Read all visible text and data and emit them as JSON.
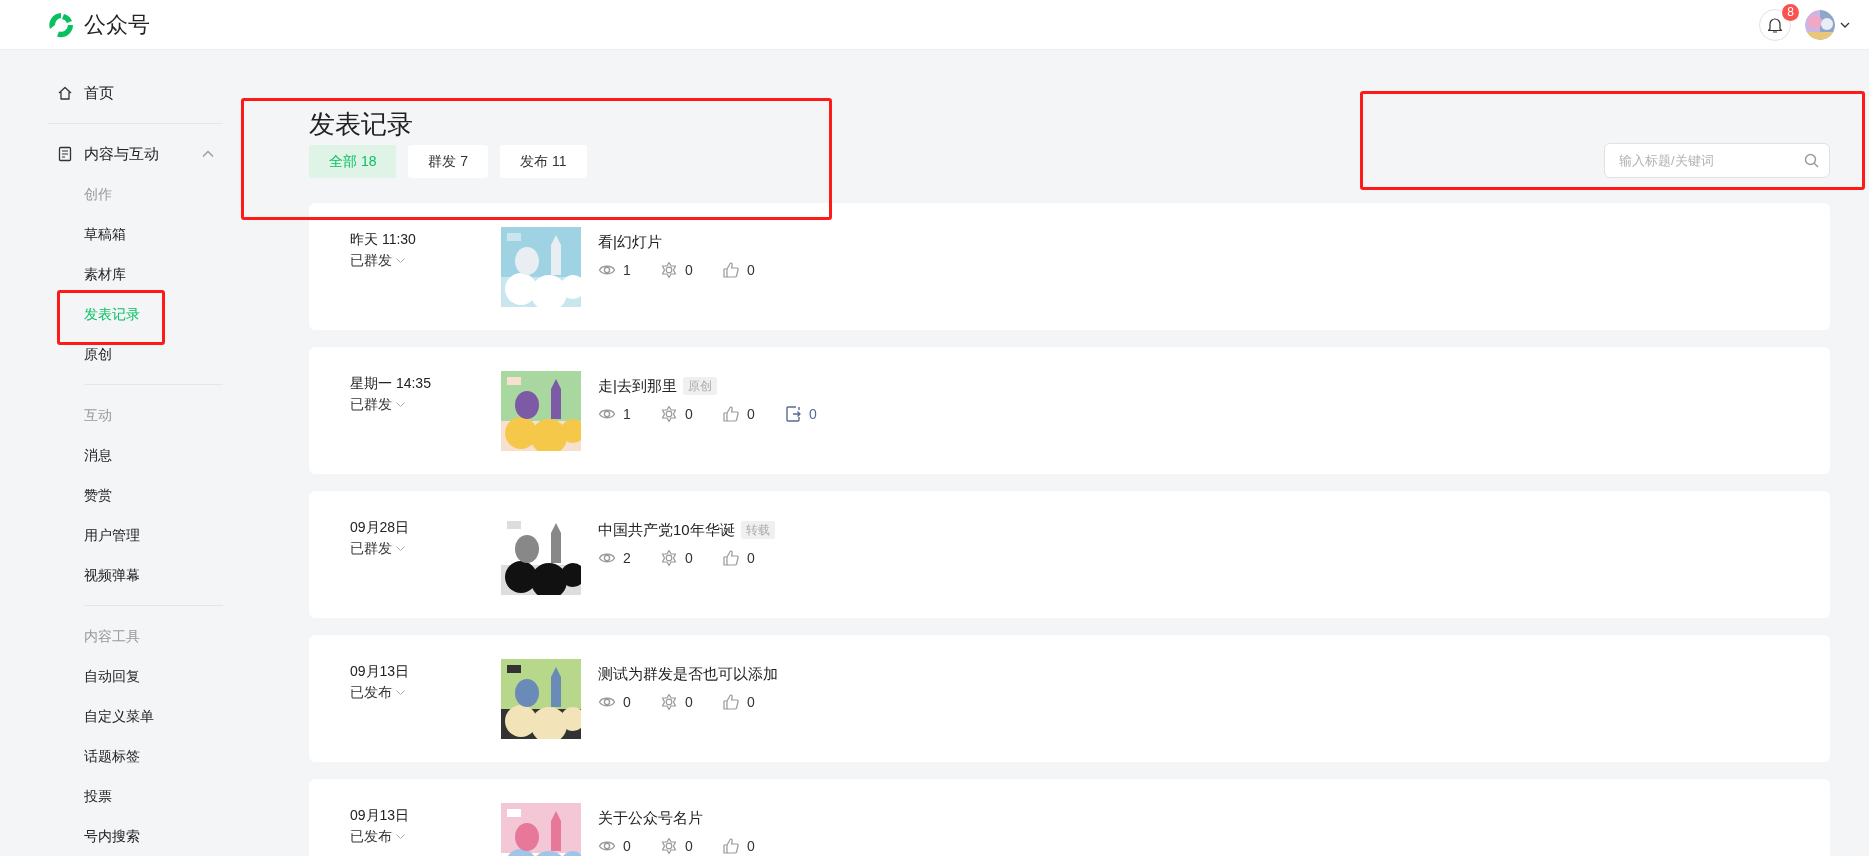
{
  "header": {
    "brand": "公众号",
    "notifications": {
      "badge": "8"
    }
  },
  "sidebar": {
    "home": {
      "label": "首页"
    },
    "group": {
      "label": "内容与互动",
      "expanded": true,
      "sections": [
        {
          "title": "创作",
          "items": [
            {
              "label": "草稿箱",
              "selected": false,
              "highlighted": false
            },
            {
              "label": "素材库",
              "selected": false,
              "highlighted": false
            },
            {
              "label": "发表记录",
              "selected": true,
              "highlighted": true
            },
            {
              "label": "原创",
              "selected": false,
              "highlighted": false
            }
          ]
        },
        {
          "title": "互动",
          "items": [
            {
              "label": "消息",
              "selected": false,
              "highlighted": false
            },
            {
              "label": "赞赏",
              "selected": false,
              "highlighted": false
            },
            {
              "label": "用户管理",
              "selected": false,
              "highlighted": false
            },
            {
              "label": "视频弹幕",
              "selected": false,
              "highlighted": false
            }
          ]
        },
        {
          "title": "内容工具",
          "items": [
            {
              "label": "自动回复",
              "selected": false,
              "highlighted": false
            },
            {
              "label": "自定义菜单",
              "selected": false,
              "highlighted": false
            },
            {
              "label": "话题标签",
              "selected": false,
              "highlighted": false
            },
            {
              "label": "投票",
              "selected": false,
              "highlighted": false
            },
            {
              "label": "号内搜索",
              "selected": false,
              "highlighted": false
            }
          ]
        }
      ]
    }
  },
  "heading": {
    "title": "发表记录",
    "highlighted": true,
    "tabs": [
      {
        "label": "全部 18",
        "selected": true
      },
      {
        "label": "群发 7",
        "selected": false
      },
      {
        "label": "发布 11",
        "selected": false
      }
    ]
  },
  "search": {
    "placeholder": "输入标题/关键词",
    "highlighted": true
  },
  "posts": [
    {
      "time": "昨天 11:30",
      "status": "已群发",
      "title": "看|幻灯片",
      "stats": [
        {
          "kind": "views",
          "count": "1"
        },
        {
          "kind": "looks",
          "count": "0"
        },
        {
          "kind": "likes",
          "count": "0"
        }
      ]
    },
    {
      "time": "星期一 14:35",
      "status": "已群发",
      "title": "走|去到那里",
      "tag": "原创",
      "stats": [
        {
          "kind": "views",
          "count": "1"
        },
        {
          "kind": "looks",
          "count": "0"
        },
        {
          "kind": "likes",
          "count": "0"
        },
        {
          "kind": "shares",
          "count": "0"
        }
      ]
    },
    {
      "time": "09月28日",
      "status": "已群发",
      "title": "中国共产党10年华诞",
      "tag": "转载",
      "stats": [
        {
          "kind": "views",
          "count": "2"
        },
        {
          "kind": "looks",
          "count": "0"
        },
        {
          "kind": "likes",
          "count": "0"
        }
      ]
    },
    {
      "time": "09月13日",
      "status": "已发布",
      "title": "测试为群发是否也可以添加",
      "stats": [
        {
          "kind": "views",
          "count": "0"
        },
        {
          "kind": "looks",
          "count": "0"
        },
        {
          "kind": "likes",
          "count": "0"
        }
      ]
    },
    {
      "time": "09月13日",
      "status": "已发布",
      "title": "关于公众号名片",
      "stats": [
        {
          "kind": "views",
          "count": "0"
        },
        {
          "kind": "looks",
          "count": "0"
        },
        {
          "kind": "likes",
          "count": "0"
        }
      ]
    }
  ]
}
